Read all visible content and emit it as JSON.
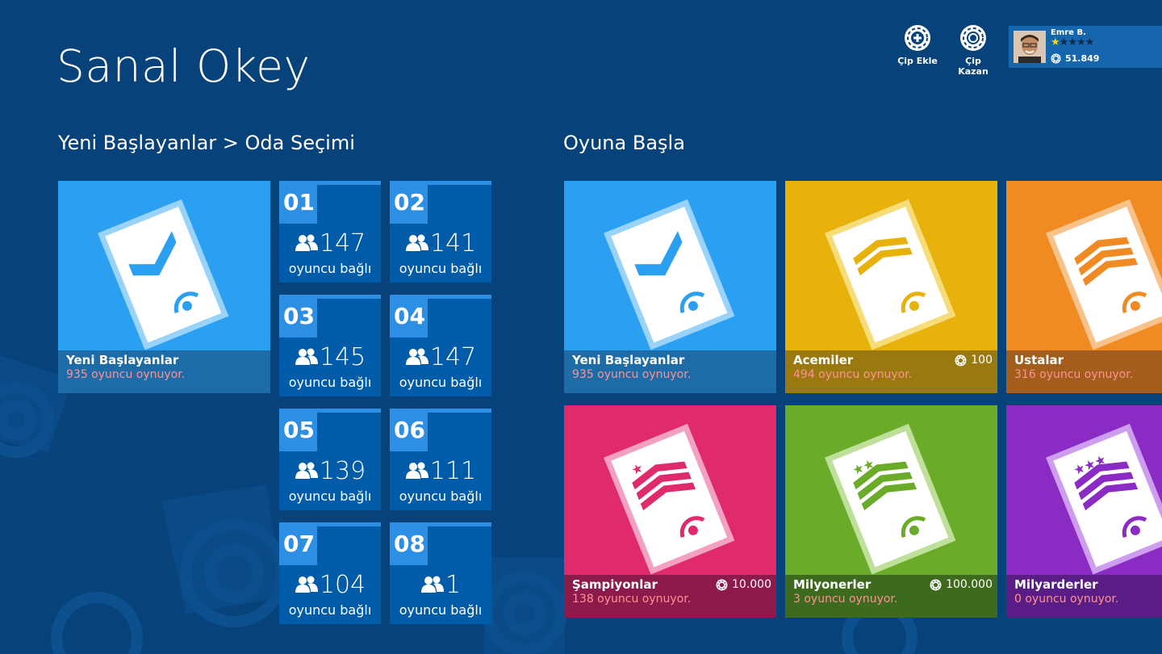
{
  "app": {
    "title": "Sanal Okey"
  },
  "top": {
    "chip_add_label": "Çip Ekle",
    "chip_earn_label": "Çip Kazan"
  },
  "user": {
    "name": "Emre B.",
    "stars_filled": 1,
    "stars_total": 5,
    "chips": "51.849"
  },
  "left": {
    "section_title": "Yeni Başlayanlar > Oda Seçimi",
    "selected": {
      "name": "Yeni Başlayanlar",
      "players": "935 oyuncu oynuyor."
    }
  },
  "rooms": [
    {
      "num": "01",
      "count": "147",
      "label": "oyuncu bağlı"
    },
    {
      "num": "02",
      "count": "141",
      "label": "oyuncu bağlı"
    },
    {
      "num": "03",
      "count": "145",
      "label": "oyuncu bağlı"
    },
    {
      "num": "04",
      "count": "147",
      "label": "oyuncu bağlı"
    },
    {
      "num": "05",
      "count": "139",
      "label": "oyuncu bağlı"
    },
    {
      "num": "06",
      "count": "111",
      "label": "oyuncu bağlı"
    },
    {
      "num": "07",
      "count": "104",
      "label": "oyuncu bağlı"
    },
    {
      "num": "08",
      "count": "1",
      "label": "oyuncu bağlı"
    }
  ],
  "right": {
    "section_title": "Oyuna Başla",
    "levels": [
      {
        "name": "Yeni Başlayanlar",
        "players": "935 oyuncu oynuyor.",
        "chips": ""
      },
      {
        "name": "Acemiler",
        "players": "494 oyuncu oynuyor.",
        "chips": "100"
      },
      {
        "name": "Ustalar",
        "players": "316 oyuncu oynuyor.",
        "chips": ""
      },
      {
        "name": "Şampiyonlar",
        "players": "138 oyuncu oynuyor.",
        "chips": "10.000"
      },
      {
        "name": "Milyonerler",
        "players": "3 oyuncu oynuyor.",
        "chips": "100.000"
      },
      {
        "name": "Milyarderler",
        "players": "0 oyuncu oynuyor.",
        "chips": ""
      }
    ]
  },
  "colors": {
    "background": "#07427a",
    "beginner": "#2b9ff0",
    "novice": "#e8b20c",
    "master": "#f08a22",
    "champion": "#df2a6e",
    "millionaire": "#6aac2a",
    "billionaire": "#8a2bc4",
    "room_tile": "#005ba8",
    "player_count_text": "#ff9292"
  },
  "icons": {
    "chip_add": "chip-plus-icon",
    "chip_earn": "chip-icon",
    "players": "people-icon",
    "chip": "chip-icon",
    "level_card": "playing-card-icon"
  }
}
